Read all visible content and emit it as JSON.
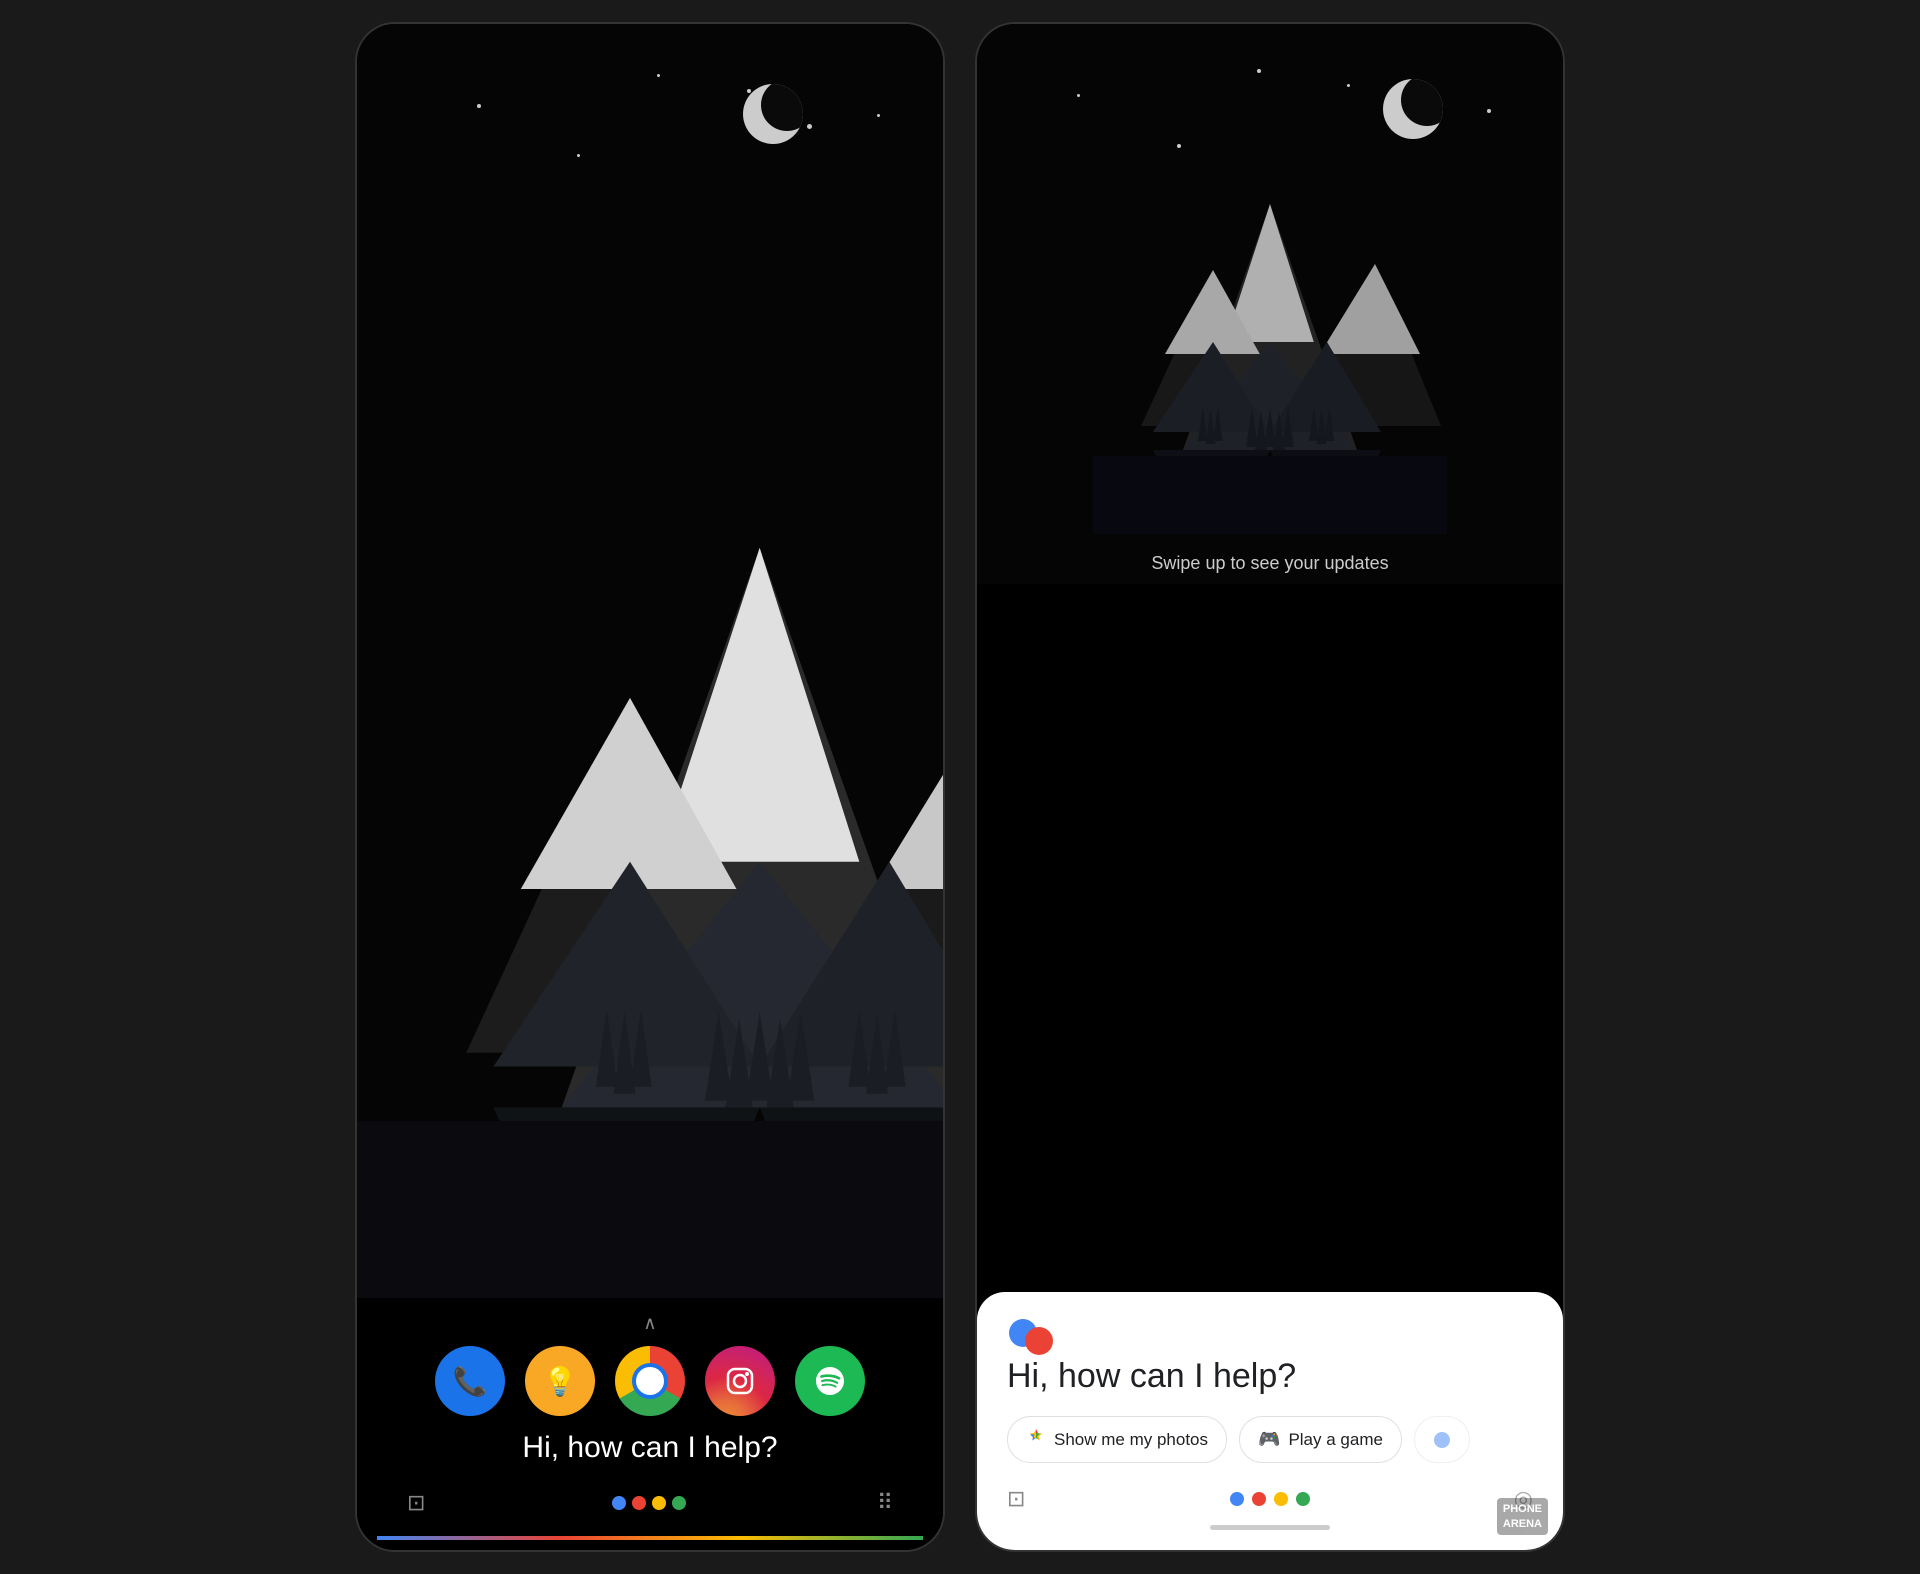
{
  "left_phone": {
    "swipe_hint": "∧",
    "apps": [
      {
        "name": "Phone",
        "icon": "📞",
        "class": "app-phone"
      },
      {
        "name": "Tips",
        "icon": "💡",
        "class": "app-bulb"
      },
      {
        "name": "Chrome",
        "icon": "",
        "class": "app-chrome"
      },
      {
        "name": "Instagram",
        "icon": "📷",
        "class": "app-instagram"
      },
      {
        "name": "Spotify",
        "icon": "🎵",
        "class": "app-spotify"
      }
    ],
    "assistant_text": "Hi, how can I help?",
    "bottom_left_icon": "⊡",
    "bottom_right_icon": "⠿"
  },
  "right_phone": {
    "swipe_label": "Swipe up to see your updates",
    "assistant_logo_alt": "Google Assistant",
    "greeting": "Hi, how can I help?",
    "chips": [
      {
        "icon": "✦",
        "label": "Show me my photos",
        "icon_color": "#ea4335"
      },
      {
        "icon": "🎮",
        "label": "Play a game"
      }
    ],
    "bottom_left_icon": "⊡",
    "home_bar": true,
    "compass_icon": "⊕"
  },
  "watermark": {
    "line1": "PHONE",
    "line2": "ARENA"
  },
  "google_colors": [
    "#4285f4",
    "#ea4335",
    "#fbbc04",
    "#34a853"
  ]
}
